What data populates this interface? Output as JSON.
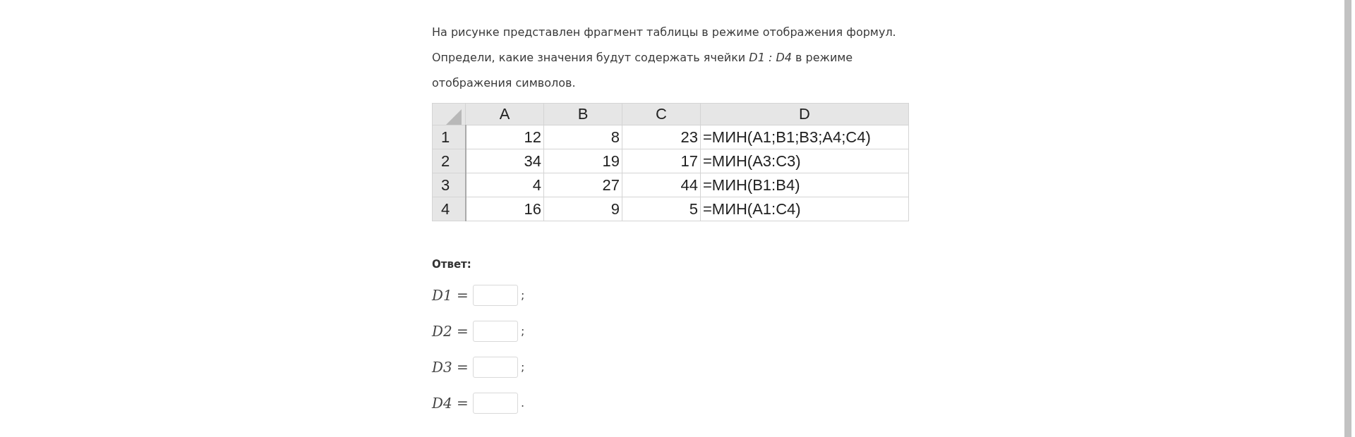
{
  "task": {
    "text": "На рисунке представлен фрагмент таблицы в режиме отображения формул. Определи, какие значения будут содержать ячейки *D1 : D4* в режиме отображения символов."
  },
  "table": {
    "columns": [
      "A",
      "B",
      "C",
      "D"
    ],
    "rows": [
      {
        "header": "1",
        "cells": [
          "12",
          "8",
          "23",
          "=МИН(A1;B1;B3;A4;C4)"
        ]
      },
      {
        "header": "2",
        "cells": [
          "34",
          "19",
          "17",
          "=МИН(A3:C3)"
        ]
      },
      {
        "header": "3",
        "cells": [
          "4",
          "27",
          "44",
          "=МИН(B1:B4)"
        ]
      },
      {
        "header": "4",
        "cells": [
          "16",
          "9",
          "5",
          "=МИН(A1:C4)"
        ]
      }
    ]
  },
  "answer": {
    "heading": "Ответ:",
    "fields": [
      {
        "label": "*D1* =",
        "punctuation": ";"
      },
      {
        "label": "*D2* =",
        "punctuation": ";"
      },
      {
        "label": "*D3* =",
        "punctuation": ";"
      },
      {
        "label": "*D4* =",
        "punctuation": "."
      }
    ]
  }
}
